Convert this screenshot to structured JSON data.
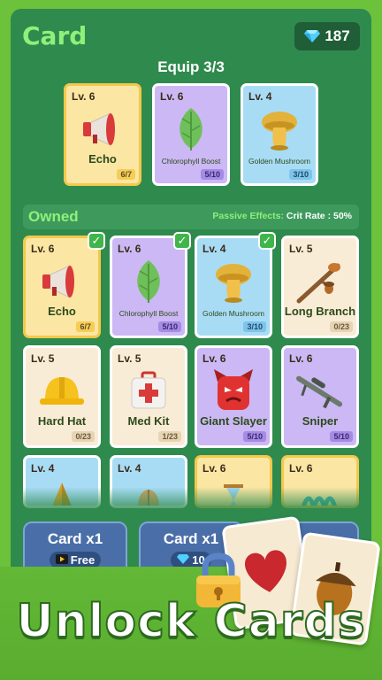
{
  "header": {
    "title": "Card",
    "gems": "187"
  },
  "equip": {
    "title": "Equip 3/3",
    "cards": [
      {
        "lv": "Lv. 6",
        "name": "Echo",
        "progress": "6/7",
        "style": "gold",
        "icon": "megaphone-icon"
      },
      {
        "lv": "Lv. 6",
        "name": "Chlorophyll Boost",
        "progress": "5/10",
        "style": "purple",
        "icon": "leaf-icon"
      },
      {
        "lv": "Lv. 4",
        "name": "Golden Mushroom",
        "progress": "3/10",
        "style": "blue",
        "icon": "mushroom-icon"
      }
    ]
  },
  "owned": {
    "label": "Owned",
    "passive_label": "Passive Effects:",
    "passive_value": "Crit Rate : 50%",
    "cards": [
      {
        "lv": "Lv. 6",
        "name": "Echo",
        "progress": "6/7",
        "style": "gold",
        "icon": "megaphone-icon",
        "equipped": true
      },
      {
        "lv": "Lv. 6",
        "name": "Chlorophyll Boost",
        "progress": "5/10",
        "style": "purple",
        "icon": "leaf-icon",
        "equipped": true
      },
      {
        "lv": "Lv. 4",
        "name": "Golden Mushroom",
        "progress": "3/10",
        "style": "blue",
        "icon": "mushroom-icon",
        "equipped": true
      },
      {
        "lv": "Lv. 5",
        "name": "Long Branch",
        "progress": "0/23",
        "style": "cream",
        "icon": "branch-icon",
        "equipped": false
      },
      {
        "lv": "Lv. 5",
        "name": "Hard Hat",
        "progress": "0/23",
        "style": "cream",
        "icon": "hard-hat-icon",
        "equipped": false
      },
      {
        "lv": "Lv. 5",
        "name": "Med Kit",
        "progress": "1/23",
        "style": "cream",
        "icon": "med-kit-icon",
        "equipped": false
      },
      {
        "lv": "Lv. 6",
        "name": "Giant Slayer",
        "progress": "5/10",
        "style": "purple",
        "icon": "devil-icon",
        "equipped": false
      },
      {
        "lv": "Lv. 6",
        "name": "Sniper",
        "progress": "5/10",
        "style": "purple",
        "icon": "sniper-rifle-icon",
        "equipped": false
      },
      {
        "lv": "Lv. 4",
        "style": "blue",
        "icon": "cone-icon"
      },
      {
        "lv": "Lv. 4",
        "style": "blue",
        "icon": "seed-icon"
      },
      {
        "lv": "Lv. 6",
        "style": "gold",
        "icon": "hourglass-icon"
      },
      {
        "lv": "Lv. 6",
        "style": "gold",
        "icon": "coil-icon"
      }
    ]
  },
  "buttons": [
    {
      "label": "Card x1",
      "sub": "Free",
      "icon": "video-icon"
    },
    {
      "label": "Card x1",
      "sub": "10",
      "icon": "gem-icon"
    },
    {
      "label": "",
      "sub": "",
      "icon": ""
    }
  ],
  "banner": {
    "text": "Unlock Cards"
  },
  "colors": {
    "panel": "#2f8a4e",
    "accent": "#8ff07a",
    "background": "#6cc23a"
  }
}
